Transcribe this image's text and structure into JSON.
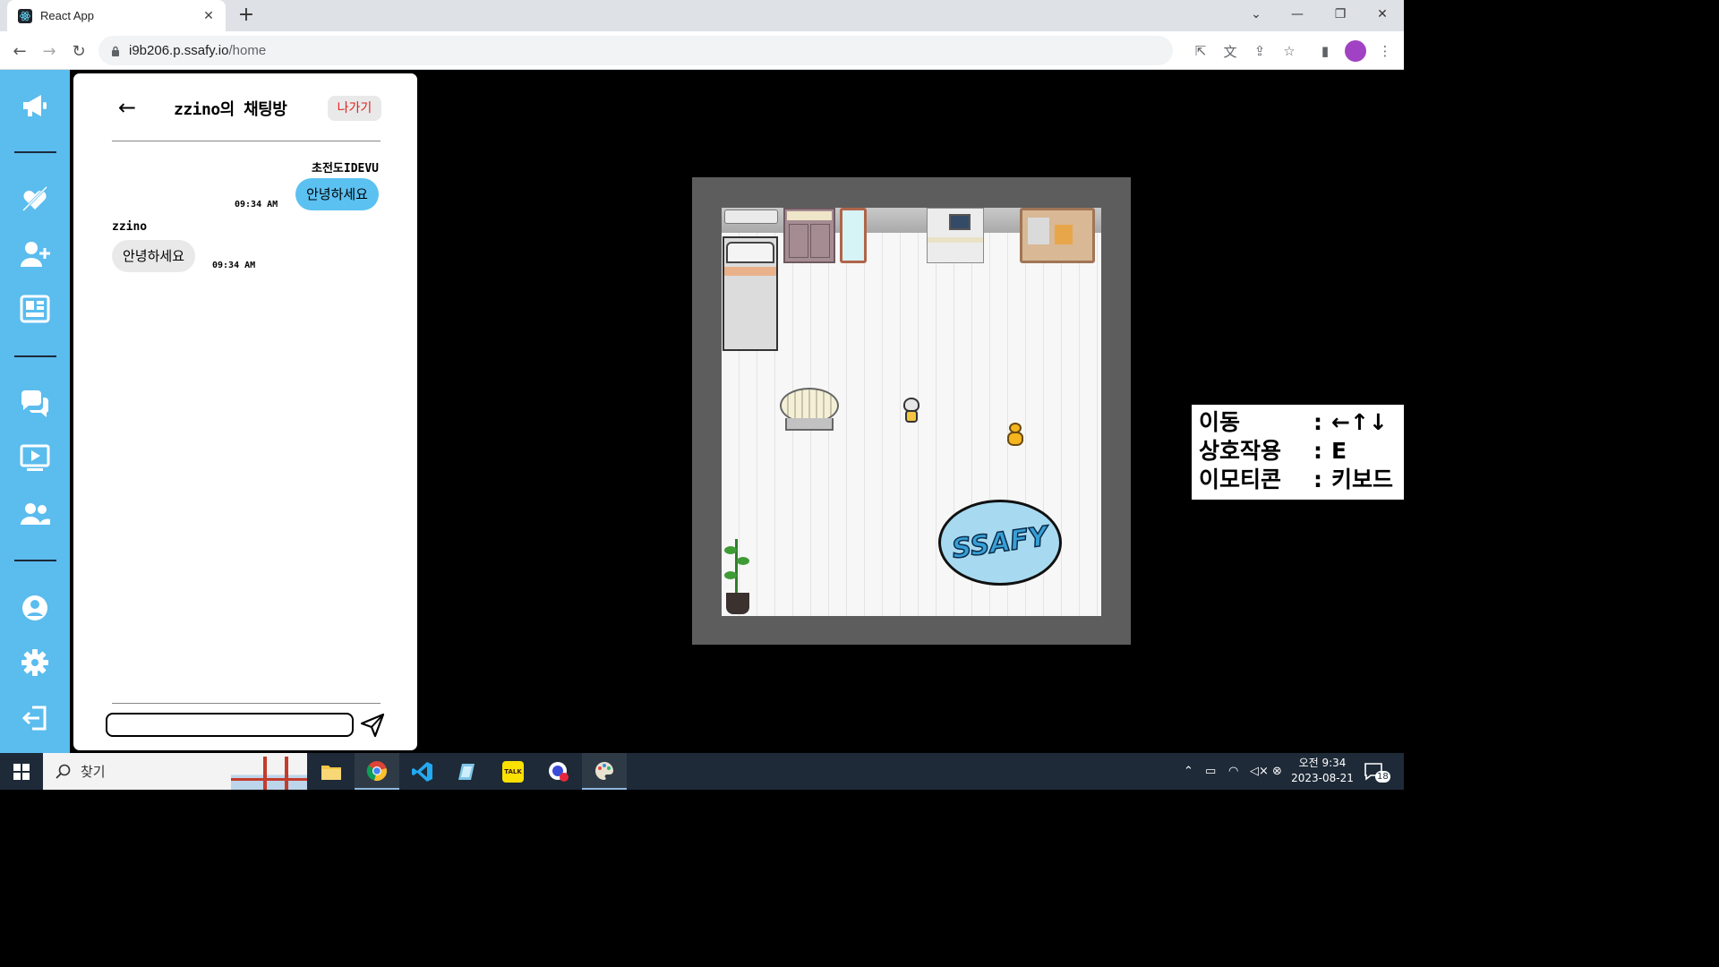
{
  "browser": {
    "tab_title": "React App",
    "url_host": "i9b206.p.ssafy.io",
    "url_path": "/home"
  },
  "chat": {
    "title": "zzino의 채팅방",
    "leave_label": "나가기",
    "messages": [
      {
        "sender": "초전도IDEVU",
        "text": "안녕하세요",
        "time": "09:34 AM",
        "mine": true
      },
      {
        "sender": "zzino",
        "text": "안녕하세요",
        "time": "09:34 AM",
        "mine": false
      }
    ],
    "input_value": ""
  },
  "game": {
    "rug_text": "SSAFY"
  },
  "controls_help": [
    {
      "key": "이동",
      "colon": ":",
      "value": "←↑↓"
    },
    {
      "key": "상호작용",
      "colon": ":",
      "value": "E"
    },
    {
      "key": "이모티콘",
      "colon": ":",
      "value": "키보드"
    }
  ],
  "taskbar": {
    "search_label": "찾기",
    "clock_time": "오전 9:34",
    "clock_date": "2023-08-21",
    "notification_count": "18"
  },
  "colors": {
    "sidebar": "#5bbcee",
    "bubble_mine": "#5bc1f1",
    "bubble_other": "#e9e9e9",
    "leave_text": "#e02020"
  }
}
